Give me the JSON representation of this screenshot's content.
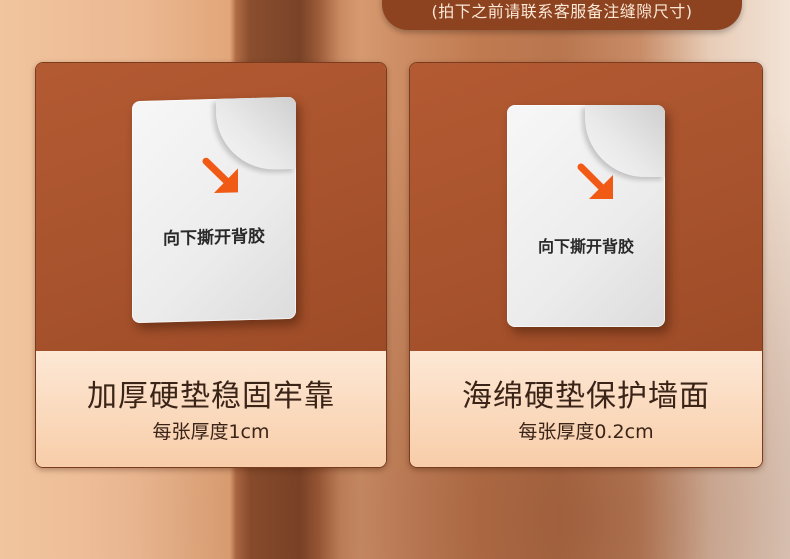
{
  "banner": {
    "text": "(拍下之前请联系客服备注缝隙尺寸)"
  },
  "cards": [
    {
      "pad_label": "向下撕开背胶",
      "title": "加厚硬垫稳固牢靠",
      "subtitle": "每张厚度1cm"
    },
    {
      "pad_label": "向下撕开背胶",
      "title": "海绵硬垫保护墙面",
      "subtitle": "每张厚度0.2cm"
    }
  ],
  "colors": {
    "card_top": "#a8532d",
    "card_bottom": "#fbdcc2",
    "arrow": "#f05a14",
    "banner": "#8e4320"
  }
}
